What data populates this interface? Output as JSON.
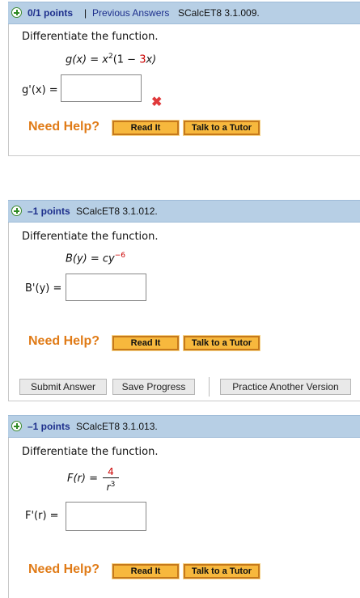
{
  "questions": [
    {
      "points": "0/1 points",
      "separator": "|",
      "previous_answers": "Previous Answers",
      "source": "SCalcET8 3.1.009.",
      "prompt": "Differentiate the function.",
      "function_lhs": "g(x) = x",
      "exponent": "2",
      "function_rhs_a": "(1 − ",
      "function_rhs_red": "3",
      "function_rhs_b": "x)",
      "answer_label": "g'(x) =",
      "answer_value": "",
      "status": "incorrect",
      "need_help": "Need Help?",
      "read_it": "Read It",
      "talk_to_tutor": "Talk to a Tutor"
    },
    {
      "points": "–1 points",
      "source": "SCalcET8 3.1.012.",
      "prompt": "Differentiate the function.",
      "function_lhs": "B(y) = cy",
      "exponent": "−6",
      "answer_label": "B'(y) =",
      "answer_value": "",
      "need_help": "Need Help?",
      "read_it": "Read It",
      "talk_to_tutor": "Talk to a Tutor"
    },
    {
      "points": "–1 points",
      "source": "SCalcET8 3.1.013.",
      "prompt": "Differentiate the function.",
      "function_lhs": "F(r) =",
      "numerator": "4",
      "denominator_base": "r",
      "denominator_exp": "3",
      "answer_label": "F'(r) =",
      "answer_value": "",
      "need_help": "Need Help?",
      "read_it": "Read It",
      "talk_to_tutor": "Talk to a Tutor"
    }
  ],
  "actions": {
    "submit": "Submit Answer",
    "save": "Save Progress",
    "practice": "Practice Another Version"
  },
  "colors": {
    "header_bg": "#b7cfe5",
    "need_help": "#e07b17",
    "button_orange": "#f7b83d",
    "wrong_mark": "#e0393b",
    "red_term": "#cc0000"
  }
}
